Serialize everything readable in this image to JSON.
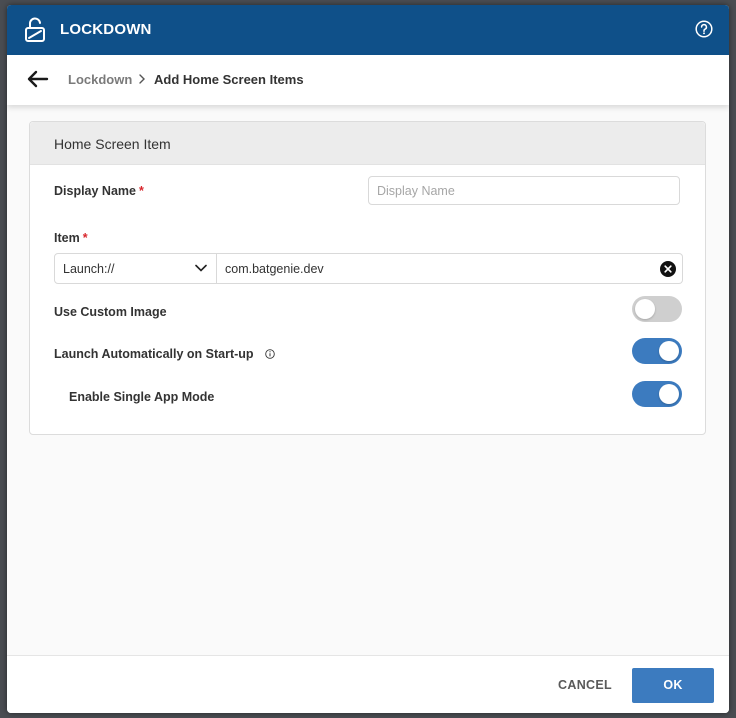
{
  "header": {
    "title": "LOCKDOWN",
    "icon": "unlock-icon",
    "help_icon": "question-circle-icon"
  },
  "breadcrumb": {
    "back_icon": "arrow-left-icon",
    "parent": "Lockdown",
    "current": "Add Home Screen Items"
  },
  "card": {
    "title": "Home Screen Item",
    "display_name": {
      "label": "Display Name",
      "required": "*",
      "placeholder": "Display Name",
      "value": ""
    },
    "item": {
      "label": "Item",
      "required": "*",
      "scheme": "Launch://",
      "value": "com.batgenie.dev"
    },
    "use_custom_image": {
      "label": "Use Custom Image",
      "enabled": false
    },
    "launch_auto": {
      "label": "Launch Automatically on Start-up",
      "enabled": true
    },
    "single_app": {
      "label": "Enable Single App Mode",
      "enabled": true
    }
  },
  "footer": {
    "cancel": "CANCEL",
    "ok": "OK"
  },
  "colors": {
    "header": "#0f5089",
    "accent": "#3c7bbf",
    "required": "#d8262c",
    "toggle_off": "#cfcfcf"
  }
}
